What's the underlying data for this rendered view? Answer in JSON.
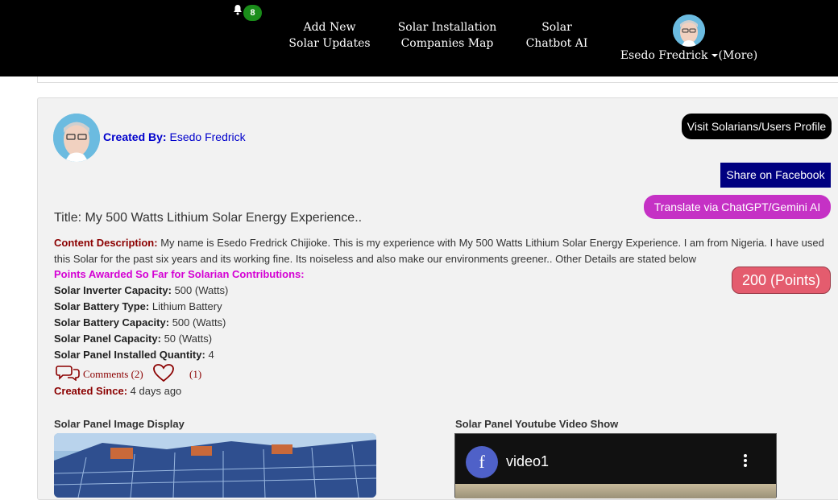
{
  "nav": {
    "notification_count": "8",
    "links": [
      {
        "line1": "Add New",
        "line2": "Solar Updates"
      },
      {
        "line1": "Solar Installation",
        "line2": "Companies Map"
      },
      {
        "line1": "Solar",
        "line2": "Chatbot AI"
      }
    ],
    "user_name": "Esedo Fredrick",
    "more_label": "(More)"
  },
  "post": {
    "created_by_label": "Created By:",
    "author": "Esedo Fredrick",
    "visit_profile_label": "Visit Solarians/Users Profile",
    "share_facebook_label": "Share on Facebook",
    "translate_label": "Translate via ChatGPT/Gemini AI",
    "title": "Title: My 500 Watts Lithium Solar Energy Experience..",
    "content_label": "Content Description:",
    "content_text": "My name is Esedo Fredrick Chijioke. This is my experience with My 500 Watts Lithium Solar Energy Experience. I am from Nigeria. I have used this Solar for the past six years and its working fine. Its noiseless and also make our environments greener.. Other Details are stated below",
    "points_label": "Points Awarded So Far for Solarian Contributions:",
    "points_value": "200 (Points)",
    "specs": [
      {
        "label": "Solar Inverter Capacity:",
        "value": "500 (Watts)"
      },
      {
        "label": "Solar Battery Type:",
        "value": "Lithium Battery"
      },
      {
        "label": "Solar Battery Capacity:",
        "value": "500 (Watts)"
      },
      {
        "label": "Solar Panel Capacity:",
        "value": "50 (Watts)"
      },
      {
        "label": "Solar Panel Installed Quantity:",
        "value": "4"
      }
    ],
    "comments_label": "Comments (2)",
    "likes_label": "(1)",
    "since_label": "Created Since:",
    "since_value": "4 days ago",
    "image_section_label": "Solar Panel Image Display",
    "video_section_label": "Solar Panel Youtube Video Show",
    "video_channel_initial": "f",
    "video_title": "video1"
  },
  "colors": {
    "nav_bg": "#000000",
    "badge": "#1a8d1a",
    "facebook_button": "#000080",
    "translate_button": "#c531c5",
    "points_badge": "#e45c6e",
    "label_maroon": "#8b0000",
    "points_label": "#d400d4",
    "author_link": "#0000cc"
  },
  "icons": {
    "notification": "bell-icon",
    "dropdown": "caret-down-icon",
    "comment": "speech-bubbles-icon",
    "like": "heart-icon",
    "video_menu": "kebab-menu-icon"
  }
}
